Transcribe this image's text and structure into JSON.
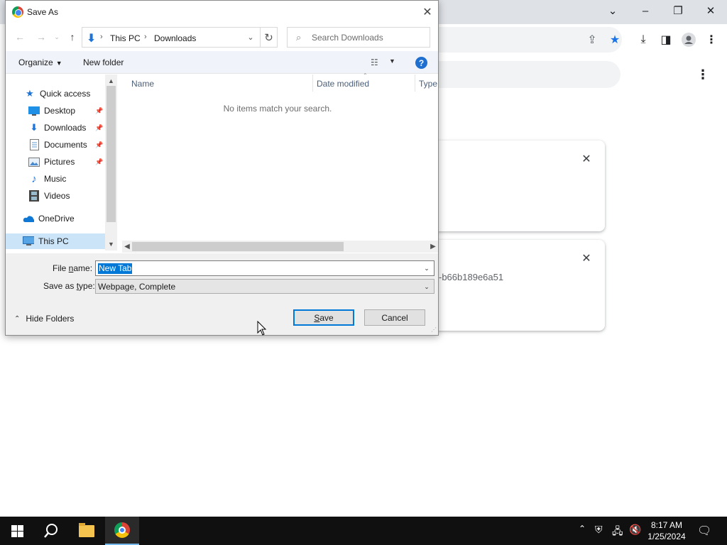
{
  "dialog": {
    "title": "Save As",
    "breadcrumb": [
      "This PC",
      "Downloads"
    ],
    "search_placeholder": "Search Downloads",
    "toolbar": {
      "organize": "Organize",
      "new_folder": "New folder"
    },
    "nav_items": [
      {
        "label": "Quick access",
        "icon": "star-icon"
      },
      {
        "label": "Desktop",
        "icon": "desktop-icon",
        "pinned": true
      },
      {
        "label": "Downloads",
        "icon": "download-arrow-icon",
        "pinned": true
      },
      {
        "label": "Documents",
        "icon": "document-icon",
        "pinned": true
      },
      {
        "label": "Pictures",
        "icon": "picture-icon",
        "pinned": true
      },
      {
        "label": "Music",
        "icon": "music-note-icon"
      },
      {
        "label": "Videos",
        "icon": "film-icon"
      },
      {
        "label": "OneDrive",
        "icon": "cloud-icon"
      },
      {
        "label": "This PC",
        "icon": "computer-icon",
        "selected": true
      }
    ],
    "columns": [
      "Name",
      "Date modified",
      "Type"
    ],
    "empty_message": "No items match your search.",
    "file_name_label_pre": "File ",
    "file_name_label_underlined": "n",
    "file_name_label_post": "ame:",
    "file_name_value": "New Tab",
    "save_type_label_pre": "Save as ",
    "save_type_label_underlined": "t",
    "save_type_label_post": "ype:",
    "save_type_value": "Webpage, Complete",
    "hide_folders": "Hide Folders",
    "save_button_underlined": "S",
    "save_button_rest": "ave",
    "cancel_button": "Cancel"
  },
  "background": {
    "card_text": "-b66b189e6a51"
  },
  "taskbar": {
    "time": "8:17 AM",
    "date": "1/25/2024"
  },
  "colors": {
    "accent": "#0078d7",
    "selection": "#cce4f7",
    "taskbar": "#101010",
    "chrome_frame": "#dee1e6",
    "bookmark_star": "#1a73e8"
  }
}
